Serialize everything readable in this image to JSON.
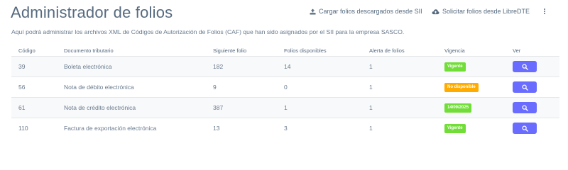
{
  "page": {
    "title": "Administrador de folios",
    "description": "Aquí podrá administrar los archivos XML de Códigos de Autorización de Folios (CAF) que han sido asignados por el SII para la empresa SASCO."
  },
  "toolbar": {
    "upload_label": "Cargar folios descargados desde SII",
    "upload_icon": "upload-icon",
    "request_label": "Solicitar folios desde LibreDTE",
    "request_icon": "cloud-upload-icon",
    "more_icon": "kebab-menu-icon"
  },
  "table": {
    "headers": [
      "Código",
      "Documento tributario",
      "Siguiente folio",
      "Folios disponibles",
      "Alerta de folios",
      "Vigencia",
      "Ver"
    ],
    "rows": [
      {
        "codigo": "39",
        "documento": "Boleta electrónica",
        "siguiente": "182",
        "disponibles": "14",
        "alerta": "1",
        "vigencia": "Vigente",
        "vigencia_color": "#71dd37",
        "ver_icon": "search-icon"
      },
      {
        "codigo": "56",
        "documento": "Nota de débito electrónica",
        "siguiente": "9",
        "disponibles": "0",
        "alerta": "1",
        "vigencia": "No disponible",
        "vigencia_color": "#ffab00",
        "ver_icon": "search-icon"
      },
      {
        "codigo": "61",
        "documento": "Nota de crédito electrónica",
        "siguiente": "387",
        "disponibles": "1",
        "alerta": "1",
        "vigencia": "14/09/2025",
        "vigencia_color": "#71dd37",
        "ver_icon": "search-icon"
      },
      {
        "codigo": "110",
        "documento": "Factura de exportación electrónica",
        "siguiente": "13",
        "disponibles": "3",
        "alerta": "1",
        "vigencia": "Vigente",
        "vigencia_color": "#71dd37",
        "ver_icon": "search-icon"
      }
    ]
  },
  "colors": {
    "primary": "#696cff",
    "text": "#566a7f",
    "success": "#71dd37",
    "warning": "#ffab00"
  }
}
